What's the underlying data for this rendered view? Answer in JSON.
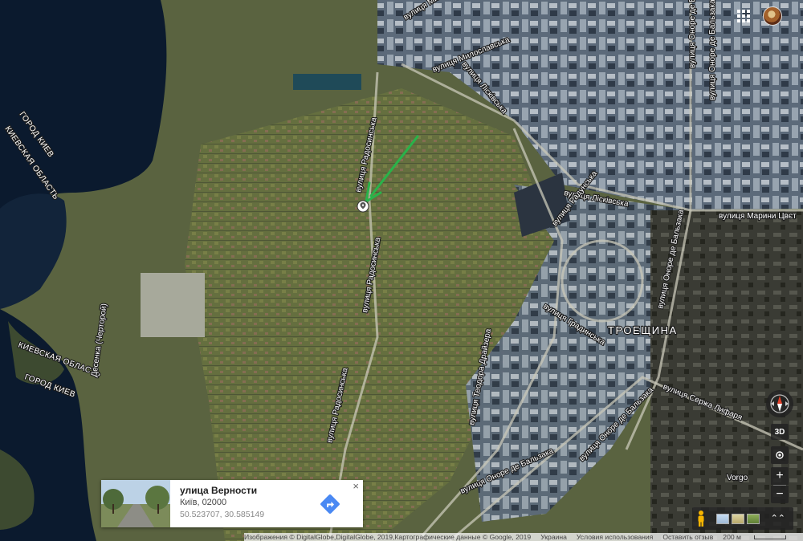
{
  "map": {
    "labels": {
      "gorod_kiev_top": "ГОРОД КИЕВ",
      "kievskaya_oblast_top": "КИЕВСКАЯ ОБЛАСТЬ",
      "kievskaya_oblast_bottom": "КИЕВСКАЯ ОБЛАСТЬ",
      "gorod_kiev_bottom": "ГОРОД КИЕВ",
      "desenka": "Десенка (Черторой)",
      "district": "ТРОЕЩИНА",
      "st_miloslavska_top": "вулиця Милославська",
      "st_miloslavska": "вулиця Милославська",
      "st_liskivska_north": "вулиця Лісківська",
      "st_liskivska_east": "вулиця Лісківська",
      "st_radunska_upper": "вулиця Радунська",
      "st_radosynska_north": "вулиця Радосинська",
      "st_radosynska_mid": "вулиця Радосинська",
      "st_radosynska_south": "вулиця Радосинська",
      "st_marini_tsvet": "вулиця Марини Цвєт",
      "st_onore_balzaka_north": "вулиця Оноре де Бальзака",
      "st_onore_balzaka_northeast": "вулиця Оноре де Бальзака",
      "st_onore_balzaka_east": "вулиця Оноре де Бальзака",
      "st_onore_balzaka_mid": "вулиця Оноре де Бальзака",
      "st_onore_balzaka_south": "вулиця Оноре де Бальзака",
      "st_gradynska": "вулиця Градинська",
      "st_teodora_draizera": "вулиця Теодора Драйзера",
      "st_serzha_lyfara": "вулиця Сержа Лифаря",
      "st_vorgo": "Vorgo"
    }
  },
  "info_card": {
    "title": "улица Верности",
    "subtitle": "Київ, 02000",
    "coords": "50.523707, 30.585149",
    "close_label": "×"
  },
  "controls": {
    "btn_3d": "3D",
    "zoom_in": "+",
    "zoom_out": "−",
    "expand": "⌃⌃"
  },
  "footer": {
    "attribution": "Изображения © DigitalGlobe,DigitalGlobe, 2019,Картографические данные © Google, 2019",
    "country": "Украина",
    "terms": "Условия использования",
    "feedback": "Оставить отзыв",
    "scale": "200 м"
  },
  "colors": {
    "water": "#0b1a2e",
    "land": "#5a6340",
    "arrow": "#29b34a",
    "direction_button": "#4a89f3"
  }
}
